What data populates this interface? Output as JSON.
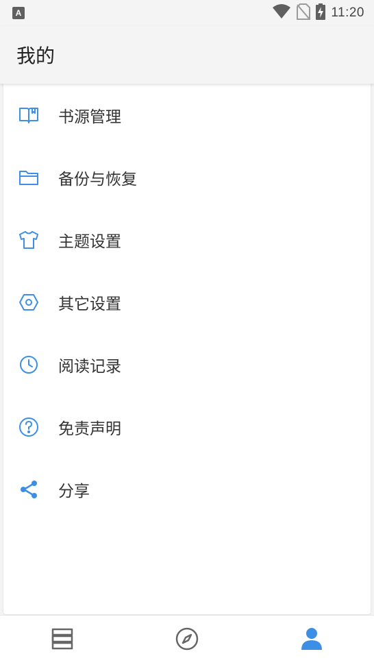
{
  "status_bar": {
    "notification_badge": "A",
    "time": "11:20",
    "icons": [
      "wifi-icon",
      "no-sim-icon",
      "battery-charging-icon"
    ]
  },
  "header": {
    "title": "我的"
  },
  "menu": {
    "items": [
      {
        "label": "书源管理",
        "icon": "book-icon"
      },
      {
        "label": "备份与恢复",
        "icon": "folder-icon"
      },
      {
        "label": "主题设置",
        "icon": "tshirt-icon"
      },
      {
        "label": "其它设置",
        "icon": "settings-hexagon-icon"
      },
      {
        "label": "阅读记录",
        "icon": "clock-icon"
      },
      {
        "label": "免责声明",
        "icon": "help-circle-icon"
      },
      {
        "label": "分享",
        "icon": "share-icon"
      }
    ]
  },
  "bottom_nav": {
    "items": [
      {
        "icon": "bookshelf-icon",
        "active": false
      },
      {
        "icon": "compass-icon",
        "active": false
      },
      {
        "icon": "person-icon",
        "active": true
      }
    ]
  },
  "colors": {
    "accent": "#3d8fe6",
    "inactive": "#666666",
    "text": "#333333",
    "background": "#f4f4f4"
  }
}
